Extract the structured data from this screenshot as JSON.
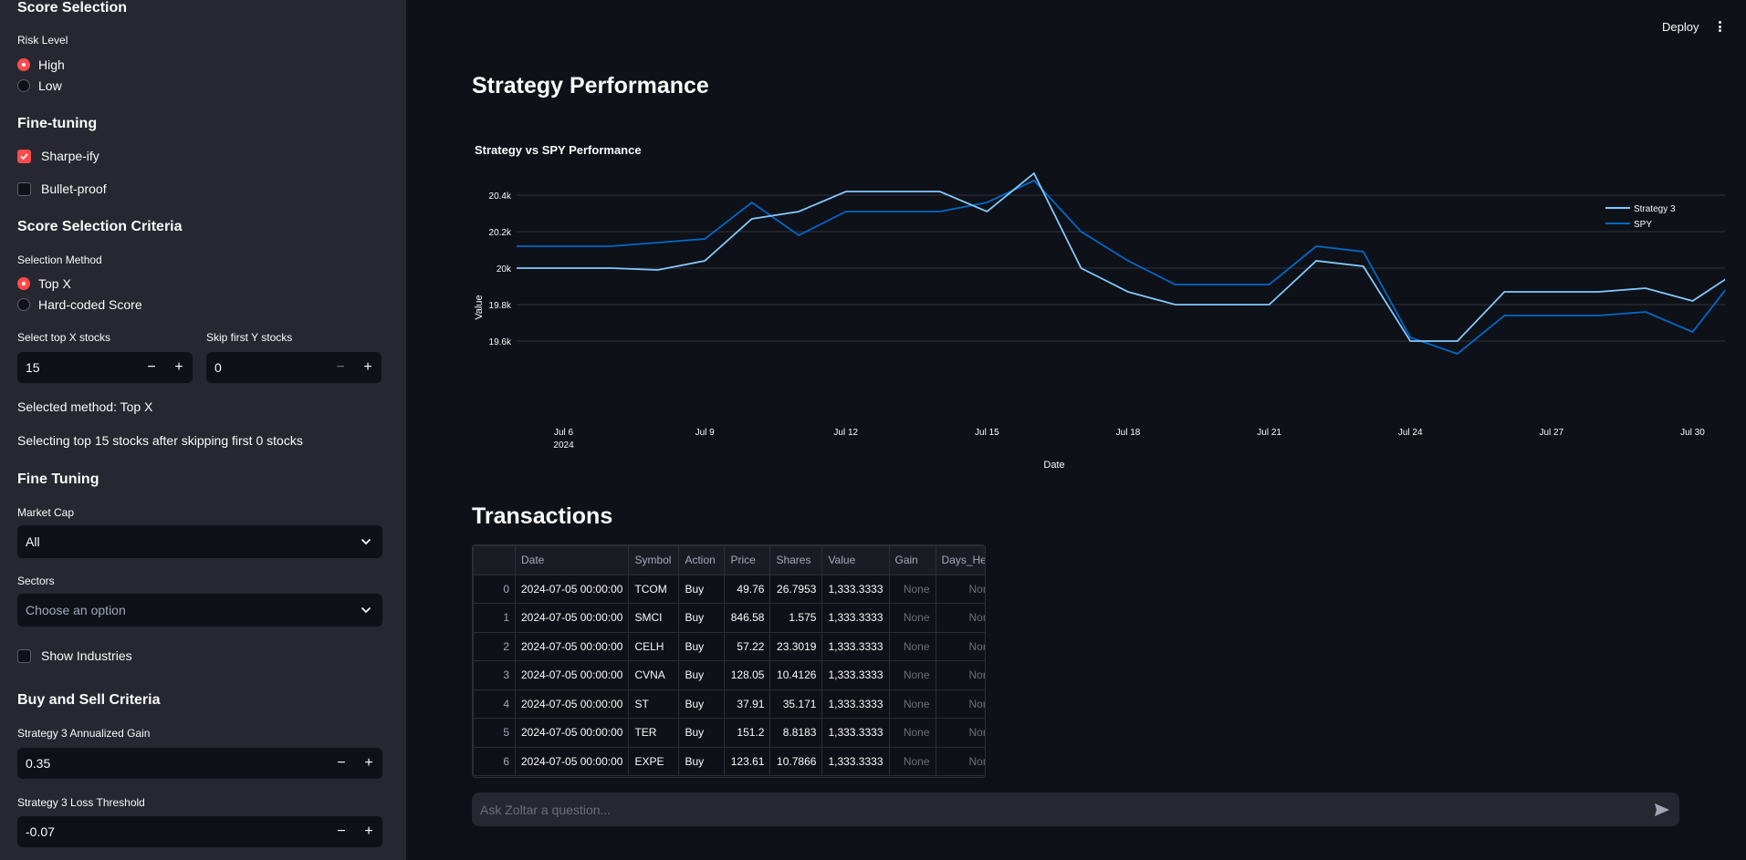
{
  "sidebar": {
    "score_selection": "Score Selection",
    "risk_level_label": "Risk Level",
    "risk_options": [
      "High",
      "Low"
    ],
    "fine_tuning_heading": "Fine-tuning",
    "sharpe": "Sharpe-ify",
    "bullet": "Bullet-proof",
    "criteria_heading": "Score Selection Criteria",
    "method_label": "Selection Method",
    "method_options": [
      "Top X",
      "Hard-coded Score"
    ],
    "top_x_label": "Select top X stocks",
    "top_x_value": "15",
    "skip_label": "Skip first Y stocks",
    "skip_value": "0",
    "selected_method": "Selected method: Top X",
    "selecting_text": "Selecting top 15 stocks after skipping first 0 stocks",
    "fine_tuning2": "Fine Tuning",
    "market_cap_label": "Market Cap",
    "market_cap_value": "All",
    "sectors_label": "Sectors",
    "sectors_placeholder": "Choose an option",
    "show_industries": "Show Industries",
    "buy_sell_heading": "Buy and Sell Criteria",
    "gain_label": "Strategy 3 Annualized Gain",
    "gain_value": "0.35",
    "loss_label": "Strategy 3 Loss Threshold",
    "loss_value": "-0.07"
  },
  "header": {
    "deploy": "Deploy"
  },
  "main": {
    "title": "Strategy Performance",
    "transactions_title": "Transactions",
    "chat_placeholder": "Ask Zoltar a question..."
  },
  "chart_data": {
    "type": "line",
    "title": "Strategy vs SPY Performance",
    "xlabel": "Date",
    "ylabel": "Value",
    "x_ticks": [
      "Jul 6",
      "Jul 9",
      "Jul 12",
      "Jul 15",
      "Jul 18",
      "Jul 21",
      "Jul 24",
      "Jul 27",
      "Jul 30"
    ],
    "x_tick_year": "2024",
    "y_ticks": [
      "19.6k",
      "19.8k",
      "20k",
      "20.2k",
      "20.4k"
    ],
    "ylim": [
      19540,
      20540
    ],
    "grid": true,
    "legend_position": "top-right",
    "x": [
      "2024-07-05",
      "2024-07-06",
      "2024-07-07",
      "2024-07-08",
      "2024-07-09",
      "2024-07-10",
      "2024-07-11",
      "2024-07-12",
      "2024-07-13",
      "2024-07-14",
      "2024-07-15",
      "2024-07-16",
      "2024-07-17",
      "2024-07-18",
      "2024-07-19",
      "2024-07-20",
      "2024-07-21",
      "2024-07-22",
      "2024-07-23",
      "2024-07-24",
      "2024-07-25",
      "2024-07-26",
      "2024-07-27",
      "2024-07-28",
      "2024-07-29",
      "2024-07-30",
      "2024-07-31"
    ],
    "series": [
      {
        "name": "Strategy 3",
        "color": "#83c9ff",
        "values": [
          20000,
          20000,
          20000,
          19990,
          20040,
          20270,
          20310,
          20420,
          20420,
          20420,
          20310,
          20520,
          20000,
          19870,
          19800,
          19800,
          19800,
          20040,
          20010,
          19600,
          19600,
          19870,
          19870,
          19870,
          19890,
          19820,
          19990
        ]
      },
      {
        "name": "SPY",
        "color": "#0068c9",
        "values": [
          20120,
          20120,
          20120,
          20140,
          20160,
          20360,
          20180,
          20310,
          20310,
          20310,
          20360,
          20480,
          20200,
          20040,
          19910,
          19910,
          19910,
          20120,
          20090,
          19620,
          19530,
          19740,
          19740,
          19740,
          19760,
          19650,
          19980
        ]
      }
    ]
  },
  "table": {
    "columns": [
      "",
      "Date",
      "Symbol",
      "Action",
      "Price",
      "Shares",
      "Value",
      "Gain",
      "Days_Held"
    ],
    "rows": [
      [
        "0",
        "2024-07-05 00:00:00",
        "TCOM",
        "Buy",
        "49.76",
        "26.7953",
        "1,333.3333",
        "None",
        "None"
      ],
      [
        "1",
        "2024-07-05 00:00:00",
        "SMCI",
        "Buy",
        "846.58",
        "1.575",
        "1,333.3333",
        "None",
        "None"
      ],
      [
        "2",
        "2024-07-05 00:00:00",
        "CELH",
        "Buy",
        "57.22",
        "23.3019",
        "1,333.3333",
        "None",
        "None"
      ],
      [
        "3",
        "2024-07-05 00:00:00",
        "CVNA",
        "Buy",
        "128.05",
        "10.4126",
        "1,333.3333",
        "None",
        "None"
      ],
      [
        "4",
        "2024-07-05 00:00:00",
        "ST",
        "Buy",
        "37.91",
        "35.171",
        "1,333.3333",
        "None",
        "None"
      ],
      [
        "5",
        "2024-07-05 00:00:00",
        "TER",
        "Buy",
        "151.2",
        "8.8183",
        "1,333.3333",
        "None",
        "None"
      ],
      [
        "6",
        "2024-07-05 00:00:00",
        "EXPE",
        "Buy",
        "123.61",
        "10.7866",
        "1,333.3333",
        "None",
        "None"
      ]
    ]
  },
  "colors": {
    "accent": "#ff4b4b",
    "bg": "#0e1117",
    "sidebar": "#262730"
  }
}
